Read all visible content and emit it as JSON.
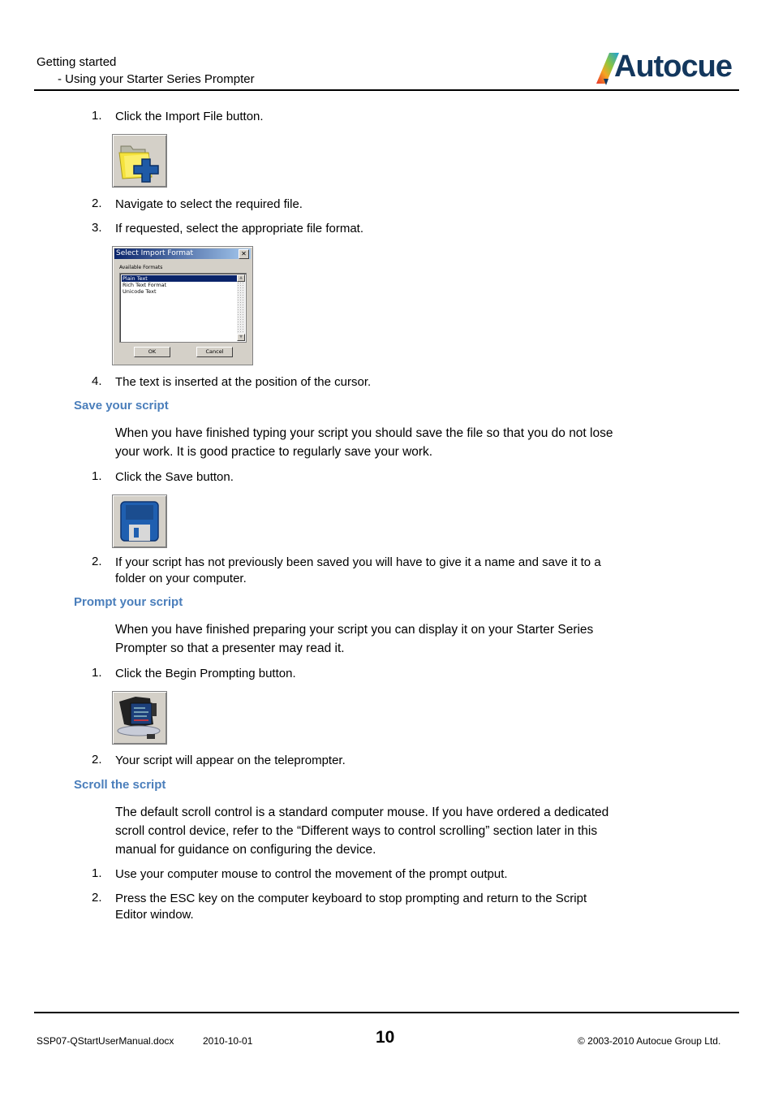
{
  "header": {
    "section": "Getting started",
    "subsection": "- Using your Starter Series Prompter",
    "logo_text": "Autocue"
  },
  "import_steps": [
    {
      "num": "1.",
      "text": "Click the Import File button."
    },
    {
      "num": "2.",
      "text": "Navigate to select the required file."
    },
    {
      "num": "3.",
      "text": "If requested, select the appropriate file format."
    },
    {
      "num": "4.",
      "text": "The text is inserted at the position of the cursor."
    }
  ],
  "import_dialog": {
    "title": "Select Import Format",
    "close_label": "✕",
    "list_label": "Available Formats",
    "options": [
      "Plain Text",
      "Rich Text Format",
      "Unicode Text"
    ],
    "selected": "Plain Text",
    "ok_label": "OK",
    "cancel_label": "Cancel"
  },
  "save_section": {
    "heading": "Save your script",
    "intro": "When you have finished typing your script you should save the file so that you do not lose your work. It is good practice to regularly save your work.",
    "steps": [
      {
        "num": "1.",
        "text": "Click the Save button."
      },
      {
        "num": "2.",
        "text": "If your script has not previously been saved you will have to give it a name and save it to a folder on your computer."
      }
    ]
  },
  "prompt_section": {
    "heading": "Prompt your script",
    "intro": "When you have finished preparing your script you can display it on your Starter Series Prompter so that a presenter may read it.",
    "steps": [
      {
        "num": "1.",
        "text": "Click the Begin Prompting button."
      },
      {
        "num": "2.",
        "text": "Your script will appear on the teleprompter."
      }
    ]
  },
  "scroll_section": {
    "heading": "Scroll the script",
    "intro": "The default scroll control is a standard computer mouse. If you have ordered a dedicated scroll control device, refer to the “Different ways to control scrolling” section later in this manual for guidance on configuring the device.",
    "steps": [
      {
        "num": "1.",
        "text": "Use your computer mouse to control the movement of the prompt output."
      },
      {
        "num": "2.",
        "text": "Press the ESC key on the computer keyboard to stop prompting and return to the Script Editor window."
      }
    ]
  },
  "footer": {
    "document": "SSP07-QStartUserManual.docx",
    "date": "2010-10-01",
    "page_number": "10",
    "copyright": "© 2003-2010 Autocue Group Ltd."
  },
  "icons": {
    "import_file": "import-file-icon",
    "save": "save-icon",
    "begin_prompting": "begin-prompting-icon"
  },
  "colors": {
    "heading": "#4a7ebb",
    "logo": "#13375d"
  }
}
